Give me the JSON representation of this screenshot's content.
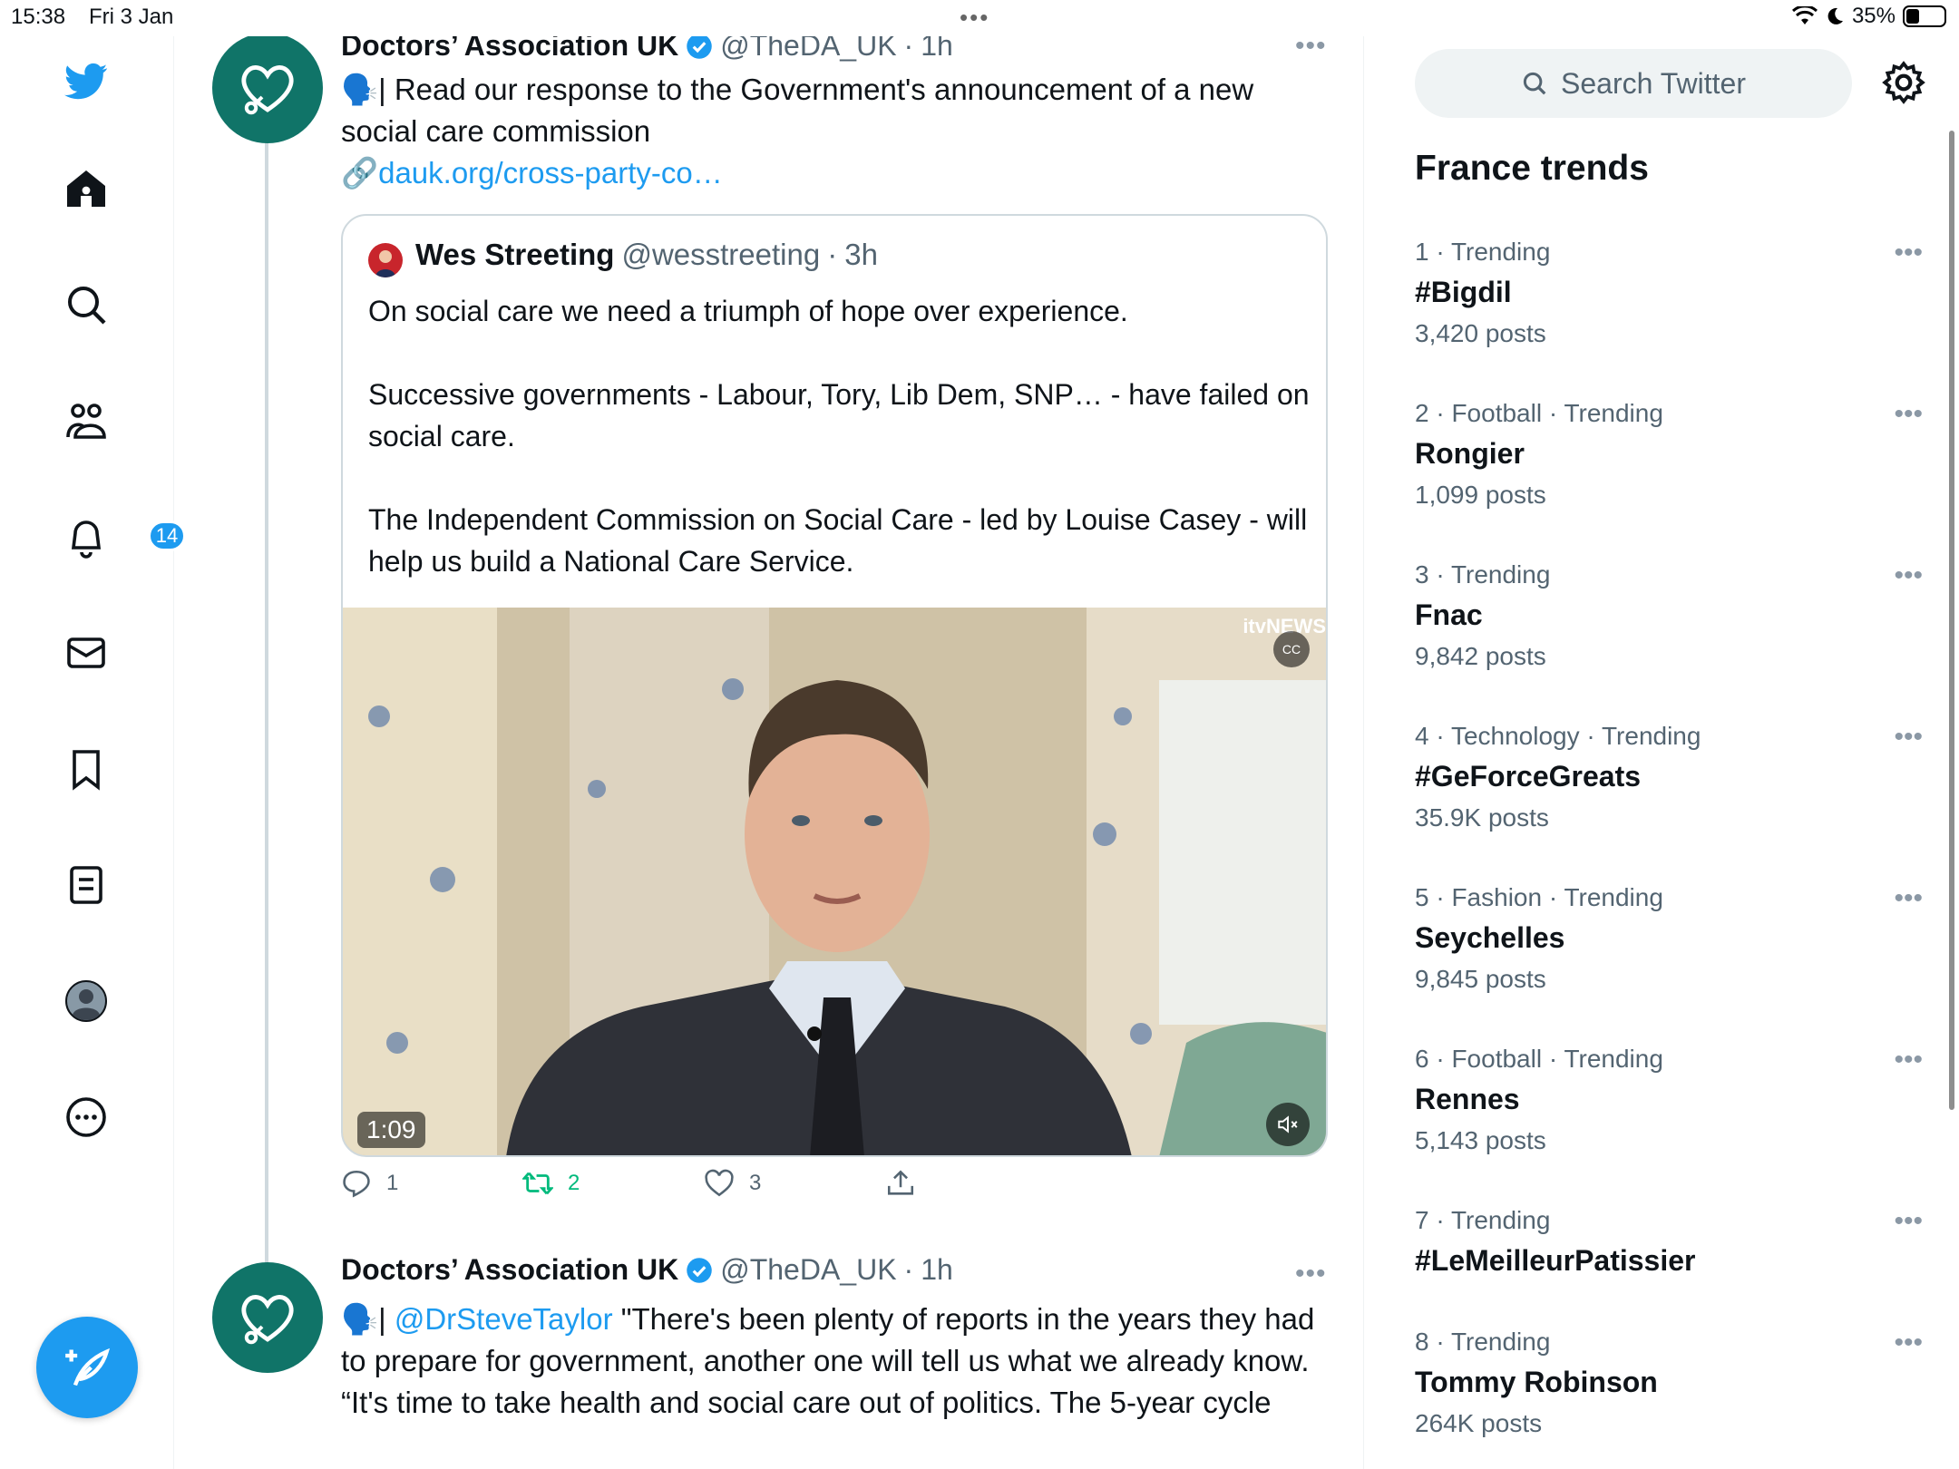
{
  "status_bar": {
    "time": "15:38",
    "date": "Fri 3 Jan",
    "battery": "35%",
    "battery_level": 0.35
  },
  "nav": {
    "notifications_badge": "14"
  },
  "colors": {
    "accent": "#1d9bf0",
    "avatar_green": "#107468",
    "retweet_green": "#00ba7c"
  },
  "tweets": [
    {
      "author": "Doctors’ Association UK",
      "handle": "@TheDA_UK",
      "time": "1h",
      "icon": "megaphone-icon",
      "text": "Read our response to the Government's announcement of a new social care commission",
      "link": "dauk.org/cross-party-co…",
      "quote": {
        "author": "Wes Streeting",
        "handle": "@wesstreeting",
        "time": "3h",
        "paragraphs": [
          "On social care we need a triumph of hope over experience.",
          "Successive governments - Labour, Tory, Lib Dem, SNP… - have failed on social care.",
          "The Independent Commission on Social Care - led by Louise Casey - will help us build a National Care Service."
        ],
        "video": {
          "duration": "1:09",
          "brand": "itvNEWS",
          "cc": "CC"
        }
      },
      "stats": {
        "replies": "1",
        "retweets": "2",
        "likes": "3"
      }
    },
    {
      "author": "Doctors’ Association UK",
      "handle": "@TheDA_UK",
      "time": "1h",
      "icon": "megaphone-icon",
      "mention": "@DrSteveTaylor",
      "text": " \"There's been plenty of reports in the years they had to prepare for government, another one will tell us what we already know.",
      "text2": "“It's time to take health and social care out of politics. The 5-year cycle"
    }
  ],
  "sidebar": {
    "search_placeholder": "Search Twitter",
    "trends_title": "France trends",
    "trends": [
      {
        "meta": "1 · Trending",
        "name": "#Bigdil",
        "count": "3,420 posts"
      },
      {
        "meta": "2 · Football · Trending",
        "name": "Rongier",
        "count": "1,099 posts"
      },
      {
        "meta": "3 · Trending",
        "name": "Fnac",
        "count": "9,842 posts"
      },
      {
        "meta": "4 · Technology · Trending",
        "name": "#GeForceGreats",
        "count": "35.9K posts"
      },
      {
        "meta": "5 · Fashion · Trending",
        "name": "Seychelles",
        "count": "9,845 posts"
      },
      {
        "meta": "6 · Football · Trending",
        "name": "Rennes",
        "count": "5,143 posts"
      },
      {
        "meta": "7 · Trending",
        "name": "#LeMeilleurPatissier",
        "count": ""
      },
      {
        "meta": "8 · Trending",
        "name": "Tommy Robinson",
        "count": "264K posts"
      }
    ]
  }
}
